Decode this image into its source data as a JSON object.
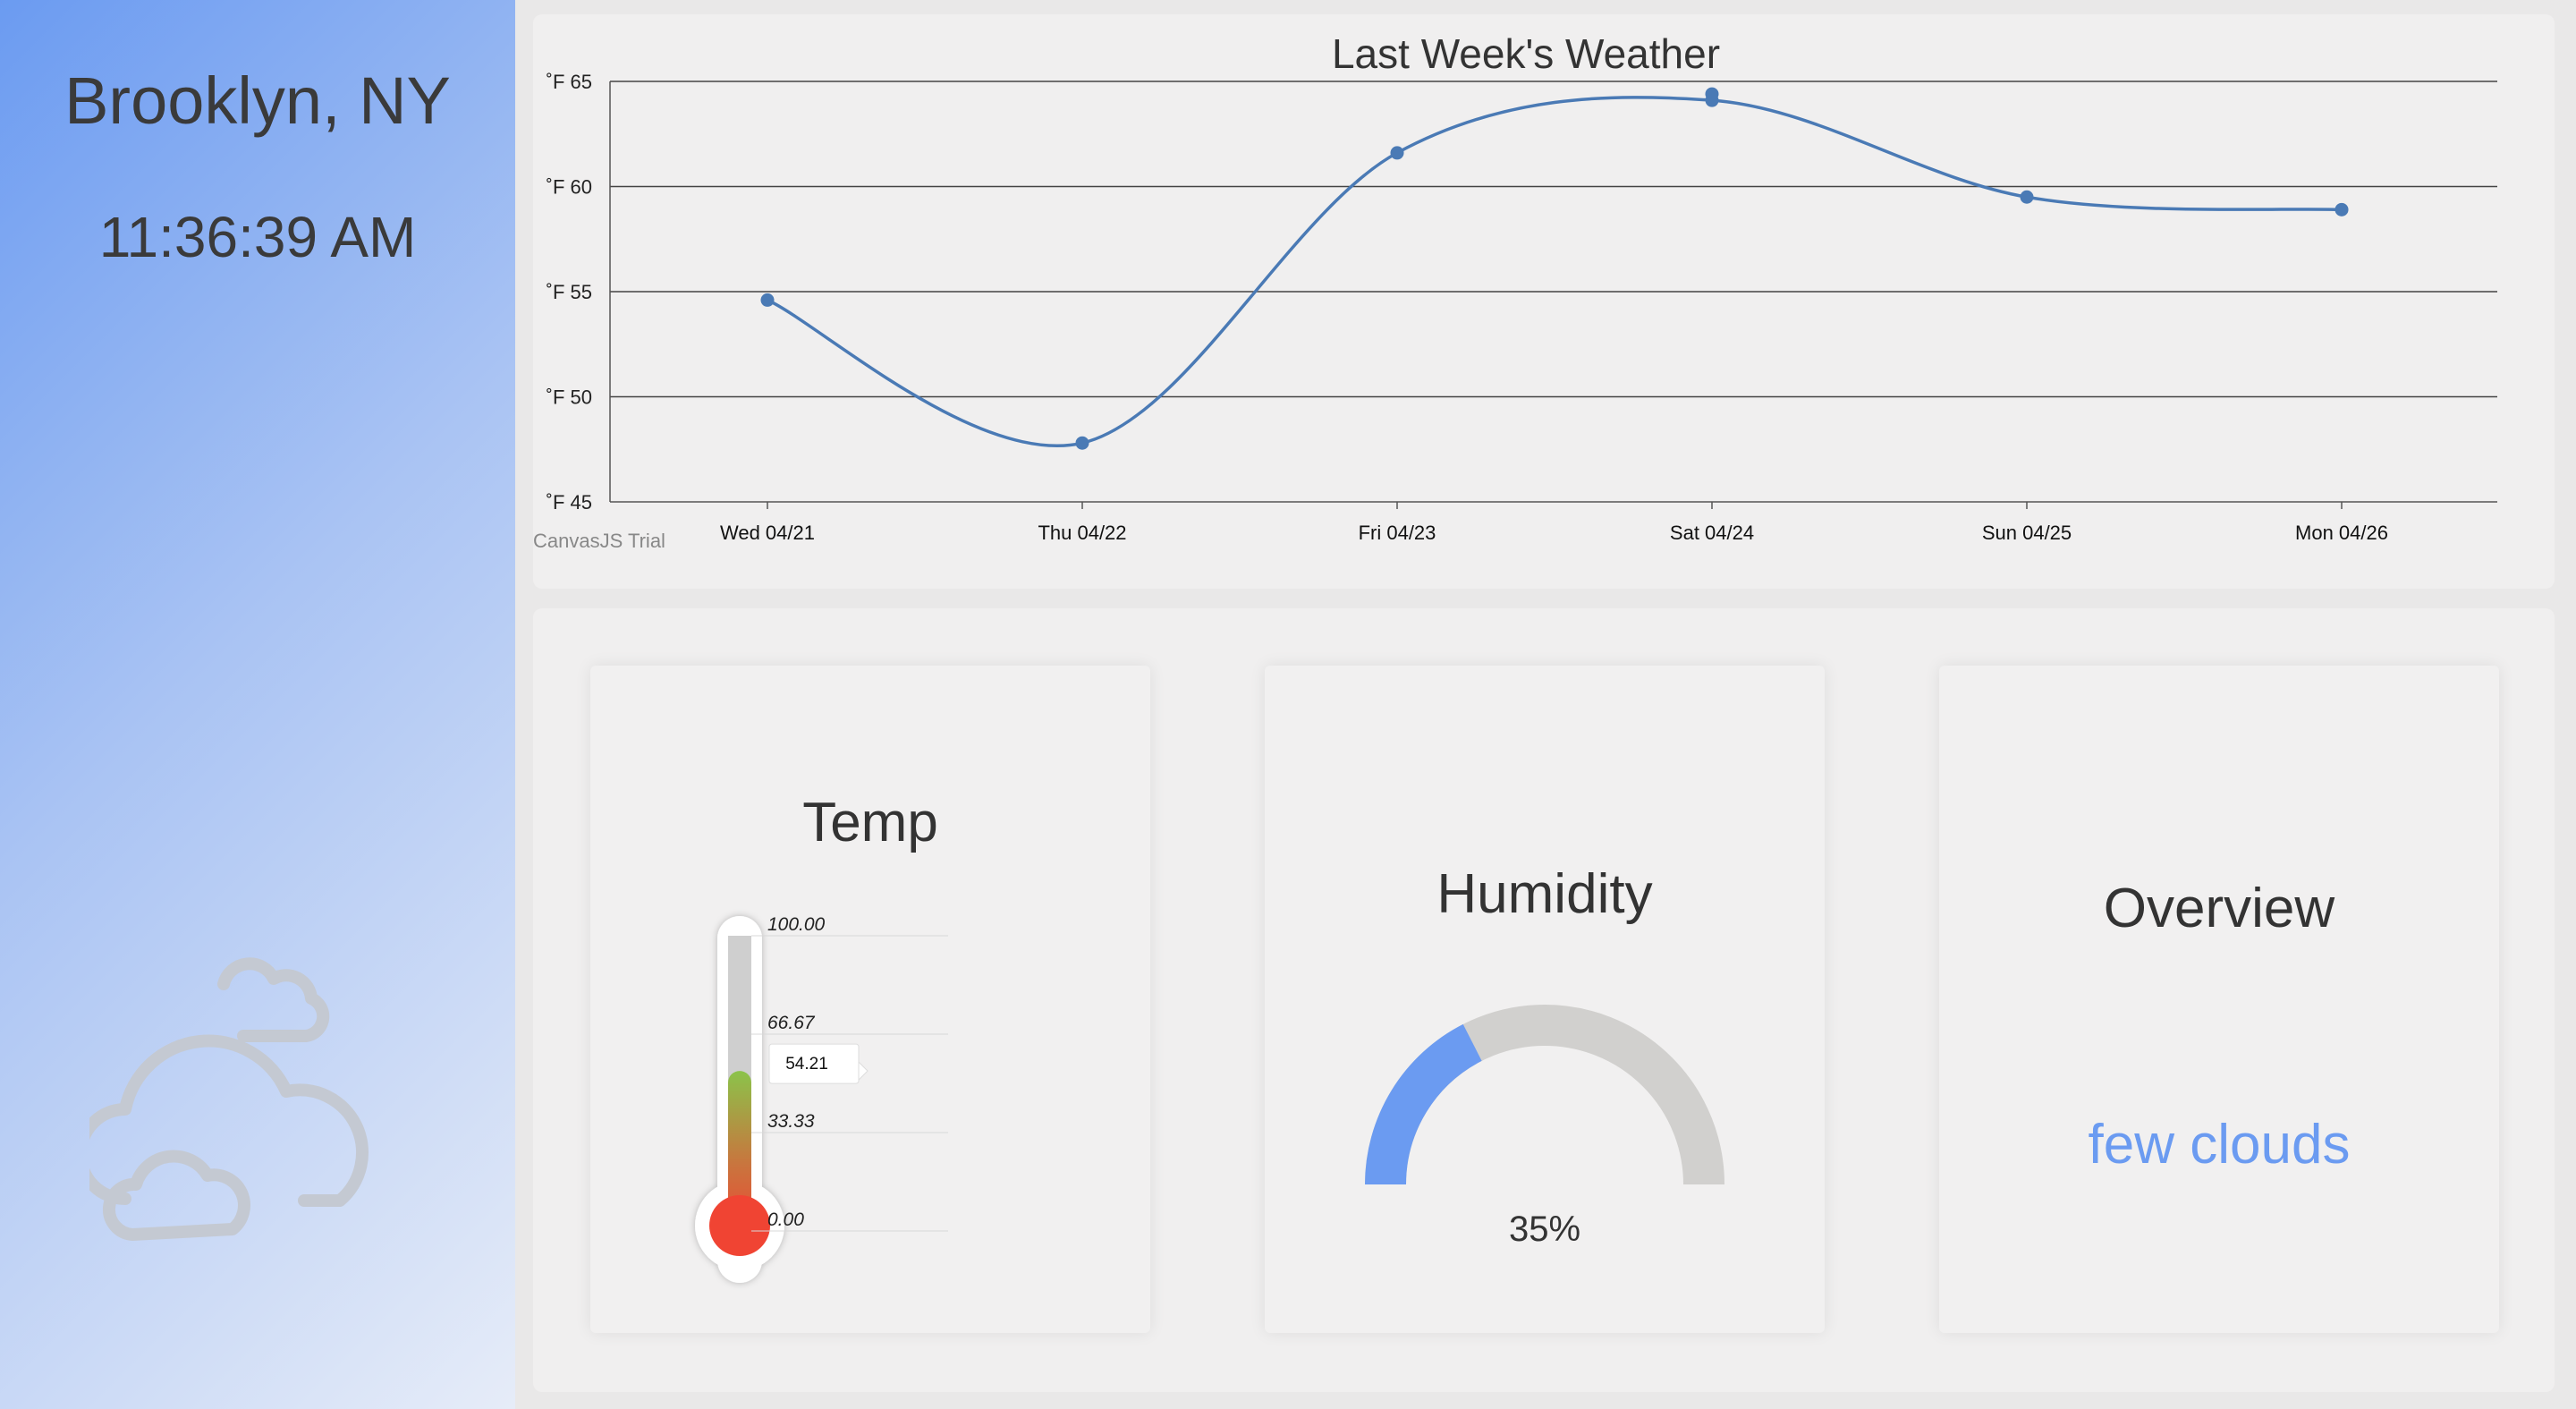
{
  "sidebar": {
    "city": "Brooklyn, NY",
    "time": "11:36:39 AM",
    "weather_icon": "cloud-icon"
  },
  "chart": {
    "watermark": "CanvasJS Trial"
  },
  "chart_data": {
    "type": "line",
    "title": "Last Week's Weather",
    "categories": [
      "Wed 04/21",
      "Thu 04/22",
      "Fri 04/23",
      "Sat 04/24",
      "Sun 04/25",
      "Mon 04/26"
    ],
    "series": [
      {
        "values": [
          54.6,
          47.8,
          61.6,
          64.1,
          59.5,
          58.9
        ]
      }
    ],
    "extra_points": [
      {
        "category": "Sat 04/24",
        "value": 64.4
      }
    ],
    "ylim": [
      45,
      65
    ],
    "yticks": [
      45,
      50,
      55,
      60,
      65
    ],
    "ytick_labels": [
      "˚F 45",
      "˚F 50",
      "˚F 55",
      "˚F 60",
      "˚F 65"
    ],
    "xlabel": "",
    "ylabel": "",
    "grid": true,
    "line_color": "#4a7ab5"
  },
  "cards": {
    "temp": {
      "title": "Temp",
      "value": 54.21,
      "value_label": "54.21",
      "scale": [
        "100.00",
        "66.67",
        "33.33",
        "0.00"
      ],
      "min": 0,
      "max": 100
    },
    "humidity": {
      "title": "Humidity",
      "value": 35,
      "value_label": "35%",
      "fill_color": "#6b9bf1",
      "track_color": "#d1d0ce"
    },
    "overview": {
      "title": "Overview",
      "description": "few clouds",
      "accent": "#6b9bf1"
    }
  }
}
